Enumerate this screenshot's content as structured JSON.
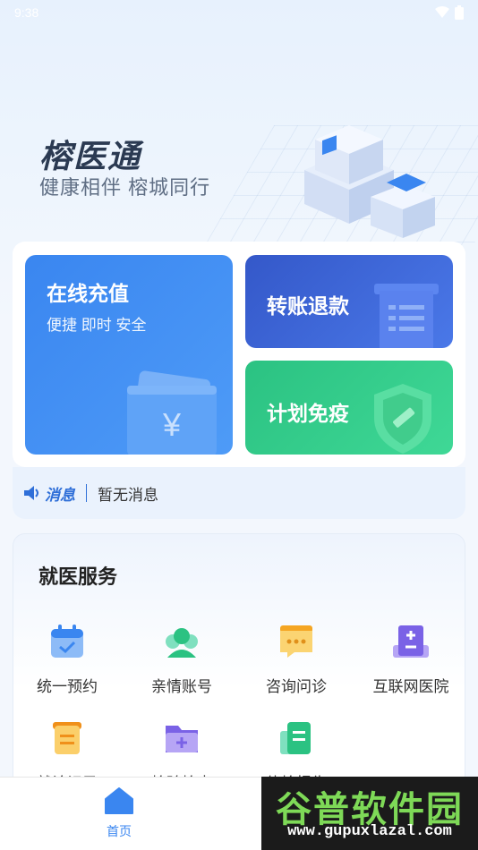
{
  "status_bar": {
    "time": "9:38",
    "icons": [
      "wifi-icon",
      "battery-icon"
    ]
  },
  "hero": {
    "title": "榕医通",
    "subtitle": "健康相伴  榕城同行"
  },
  "cards": {
    "recharge": {
      "title": "在线充值",
      "subtitle": "便捷 即时 安全"
    },
    "refund": {
      "title": "转账退款"
    },
    "vaccine": {
      "title": "计划免疫"
    }
  },
  "notice": {
    "label": "消息",
    "text": "暂无消息"
  },
  "services": {
    "title": "就医服务",
    "items": [
      {
        "label": "统一预约",
        "icon": "calendar-icon"
      },
      {
        "label": "亲情账号",
        "icon": "family-account-icon"
      },
      {
        "label": "咨询问诊",
        "icon": "chat-icon"
      },
      {
        "label": "互联网医院",
        "icon": "hospital-icon"
      },
      {
        "label": "就诊记录",
        "icon": "record-icon"
      },
      {
        "label": "检验检查",
        "icon": "folder-medical-icon"
      },
      {
        "label": "体检报告",
        "icon": "report-icon"
      }
    ]
  },
  "tabbar": {
    "home_label": "首页"
  },
  "watermark": {
    "title": "谷普软件园",
    "url": "www.gupuxlazal.com"
  },
  "colors": {
    "primary": "#3a86f0",
    "refund": "#3458c9",
    "vaccine": "#2bc282",
    "title_text": "#2b3a52"
  }
}
